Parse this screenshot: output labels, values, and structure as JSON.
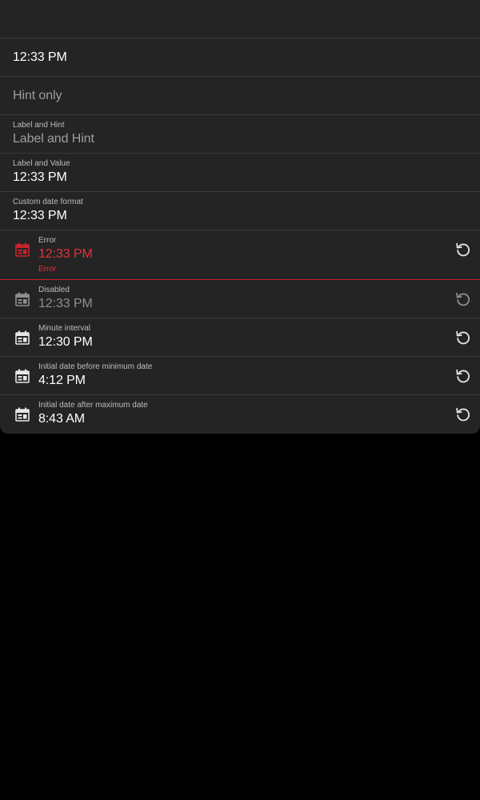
{
  "fields": [
    {
      "id": "plain",
      "value": "12:33 PM"
    },
    {
      "id": "hint-only",
      "hint": "Hint only"
    },
    {
      "id": "label-and-hint",
      "label": "Label and Hint",
      "hint": "Label and Hint"
    },
    {
      "id": "label-and-value",
      "label": "Label and Value",
      "value": "12:33 PM"
    },
    {
      "id": "custom-format",
      "label": "Custom date format",
      "value": "12:33 PM"
    },
    {
      "id": "error",
      "label": "Error",
      "value": "12:33 PM",
      "error_text": "Error"
    },
    {
      "id": "disabled",
      "label": "Disabled",
      "value": "12:33 PM"
    },
    {
      "id": "minute-interval",
      "label": "Minute interval",
      "value": "12:30 PM"
    },
    {
      "id": "before-min",
      "label": "Initial date before minimum date",
      "value": "4:12 PM"
    },
    {
      "id": "after-max",
      "label": "Initial date after maximum date",
      "value": "8:43 AM"
    }
  ],
  "icons": {
    "calendar": "calendar-icon",
    "reset": "reset-icon"
  },
  "colors": {
    "surface": "#242424",
    "background": "#000000",
    "divider": "#3a3a3a",
    "error": "#e0343b",
    "text": "#ffffff",
    "hint": "#9e9e9e"
  }
}
